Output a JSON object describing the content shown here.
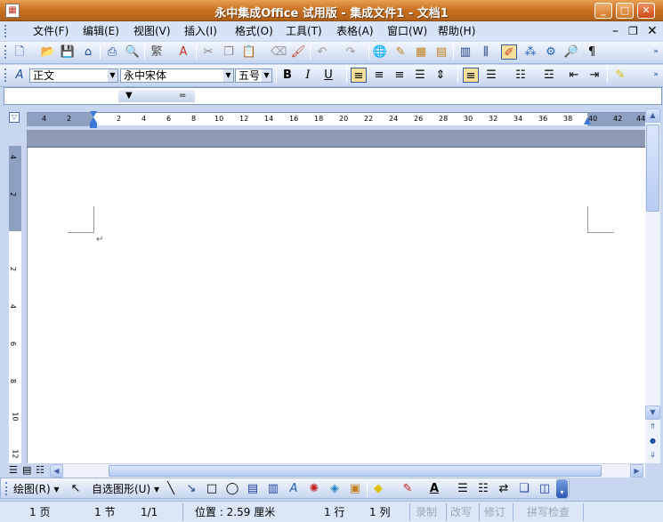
{
  "window": {
    "title": "永中集成Office 试用版 - 集成文件1 - 文档1",
    "app_icon": "office-app-icon",
    "buttons": {
      "minimize": "_",
      "maximize": "□",
      "close": "✕"
    }
  },
  "menu": {
    "items": [
      "文件(F)",
      "编辑(E)",
      "视图(V)",
      "插入(I)",
      "格式(O)",
      "工具(T)",
      "表格(A)",
      "窗口(W)",
      "帮助(H)"
    ],
    "doc_controls": {
      "minimize": "–",
      "restore": "❐",
      "close": "✕"
    }
  },
  "format": {
    "style": "正文",
    "font": "永中宋体",
    "size": "五号",
    "bold": "B",
    "italic": "I",
    "underline": "U"
  },
  "ruler": {
    "labels": [
      "4",
      "2",
      "2",
      "4",
      "6",
      "8",
      "10",
      "12",
      "14",
      "16",
      "18",
      "20",
      "22",
      "24",
      "26",
      "28",
      "30",
      "32",
      "34",
      "36",
      "38",
      "40",
      "42",
      "44"
    ],
    "vlabels": [
      "4",
      "2",
      "2",
      "4",
      "6",
      "8",
      "10",
      "12"
    ]
  },
  "drawing": {
    "draw_label": "绘图(R)",
    "autoshape_label": "自选图形(U)"
  },
  "status": {
    "page": "1 页",
    "section": "1 节",
    "pages": "1/1",
    "position": "位置 : 2.59 厘米",
    "line": "1 行",
    "column": "1 列",
    "rec": "录制",
    "ovr": "改写",
    "trk": "修订",
    "spell": "拼写检查"
  },
  "colors": {
    "title_bar": "#c87020",
    "toolbar": "#d7e4f7",
    "document": "#ffffff"
  }
}
